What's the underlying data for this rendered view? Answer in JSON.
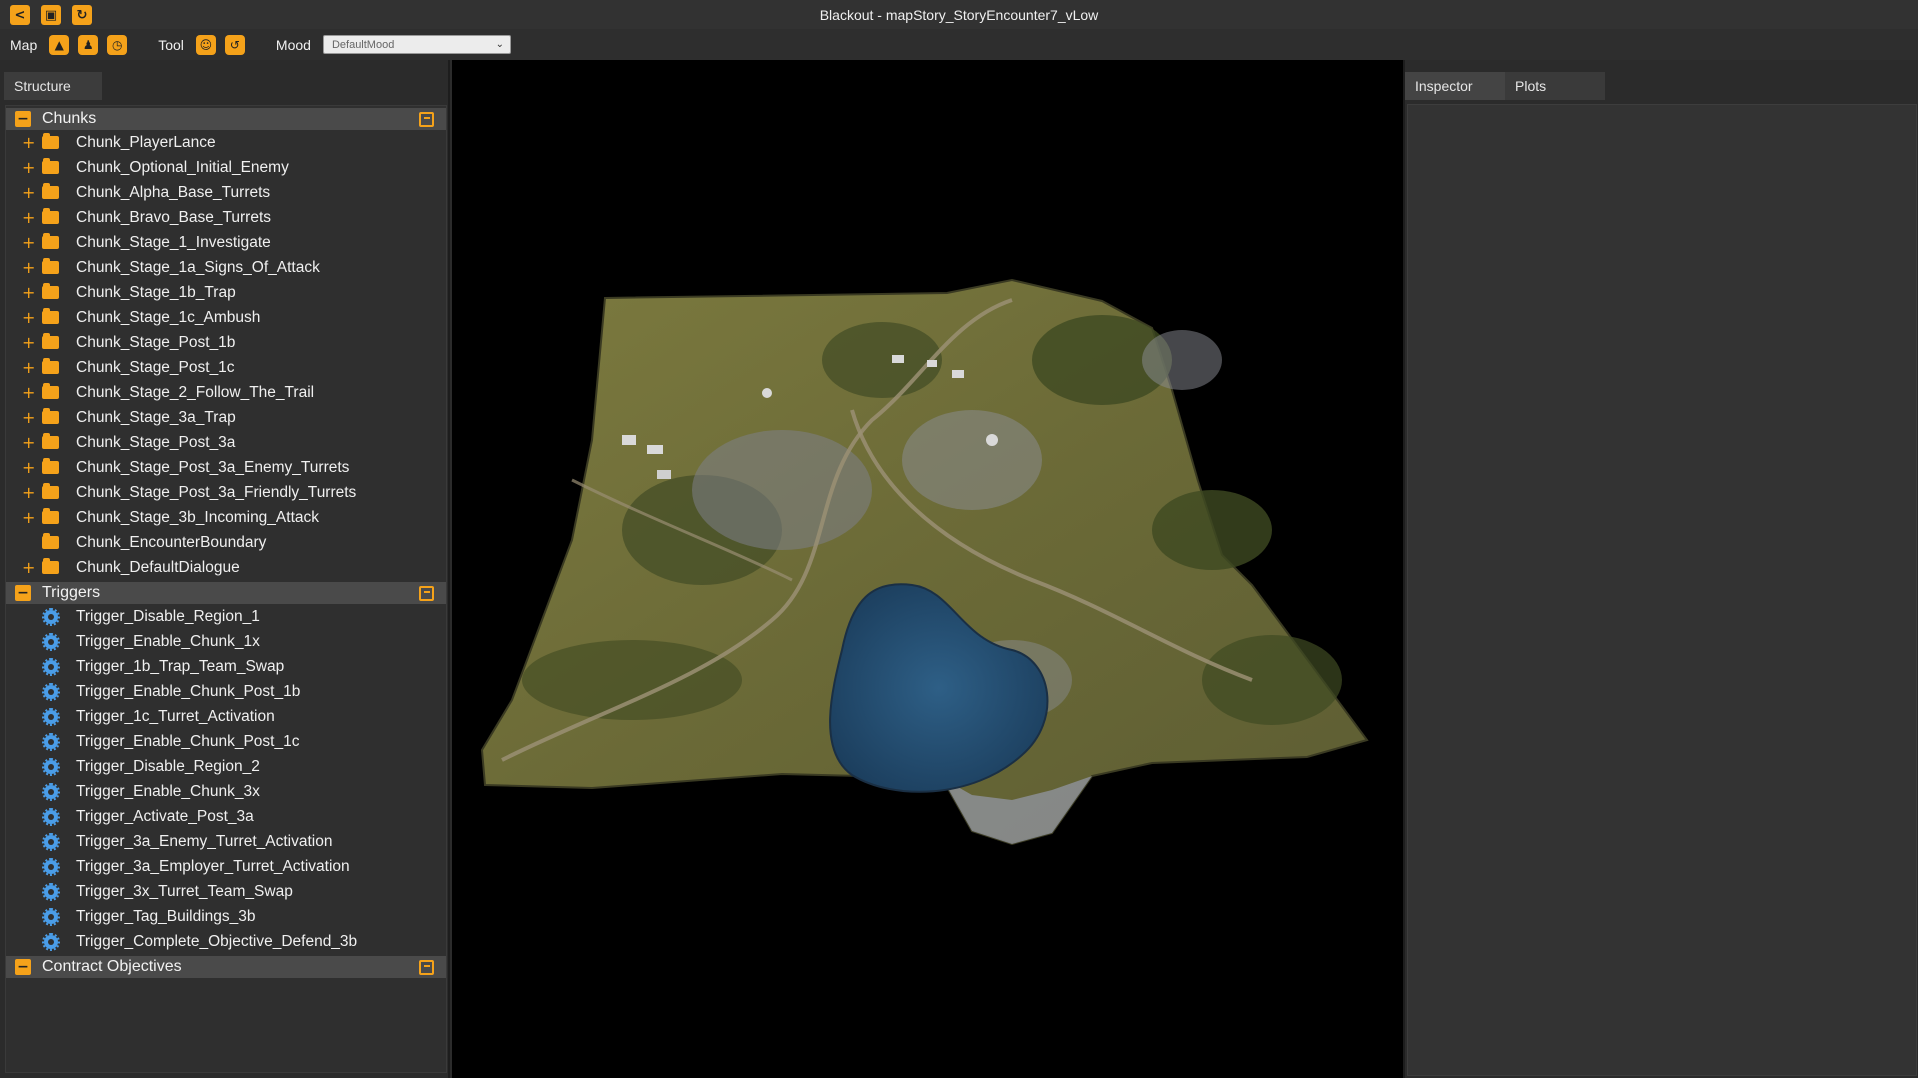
{
  "window": {
    "title": "Blackout - mapStory_StoryEncounter7_vLow"
  },
  "titlebar_icons": [
    "back-icon",
    "save-icon",
    "refresh-icon"
  ],
  "toolbar": {
    "map_label": "Map",
    "map_tools": [
      "terrain-icon",
      "spawn-icon",
      "clock-icon"
    ],
    "tool_label": "Tool",
    "tool_tools": [
      "select-tool-icon",
      "rotate-tool-icon"
    ],
    "mood_label": "Mood",
    "mood_value": "DefaultMood"
  },
  "left_panel": {
    "tab": "Structure",
    "sections": {
      "chunks": {
        "title": "Chunks",
        "items": [
          "Chunk_PlayerLance",
          "Chunk_Optional_Initial_Enemy",
          "Chunk_Alpha_Base_Turrets",
          "Chunk_Bravo_Base_Turrets",
          "Chunk_Stage_1_Investigate",
          "Chunk_Stage_1a_Signs_Of_Attack",
          "Chunk_Stage_1b_Trap",
          "Chunk_Stage_1c_Ambush",
          "Chunk_Stage_Post_1b",
          "Chunk_Stage_Post_1c",
          "Chunk_Stage_2_Follow_The_Trail",
          "Chunk_Stage_3a_Trap",
          "Chunk_Stage_Post_3a",
          "Chunk_Stage_Post_3a_Enemy_Turrets",
          "Chunk_Stage_Post_3a_Friendly_Turrets",
          "Chunk_Stage_3b_Incoming_Attack",
          "Chunk_EncounterBoundary",
          "Chunk_DefaultDialogue"
        ]
      },
      "triggers": {
        "title": "Triggers",
        "items": [
          "Trigger_Disable_Region_1",
          "Trigger_Enable_Chunk_1x",
          "Trigger_1b_Trap_Team_Swap",
          "Trigger_Enable_Chunk_Post_1b",
          "Trigger_1c_Turret_Activation",
          "Trigger_Enable_Chunk_Post_1c",
          "Trigger_Disable_Region_2",
          "Trigger_Enable_Chunk_3x",
          "Trigger_Activate_Post_3a",
          "Trigger_3a_Enemy_Turret_Activation",
          "Trigger_3a_Employer_Turret_Activation",
          "Trigger_3x_Turret_Team_Swap",
          "Trigger_Tag_Buildings_3b",
          "Trigger_Complete_Objective_Defend_3b"
        ]
      },
      "objectives": {
        "title": "Contract Objectives"
      }
    }
  },
  "right_panel": {
    "tabs": [
      "Inspector",
      "Plots"
    ]
  },
  "colors": {
    "accent": "#f5a21a",
    "trigger_icon": "#4a9de8",
    "panel_bg": "#2b2b2b",
    "viewport_bg": "#000000"
  }
}
